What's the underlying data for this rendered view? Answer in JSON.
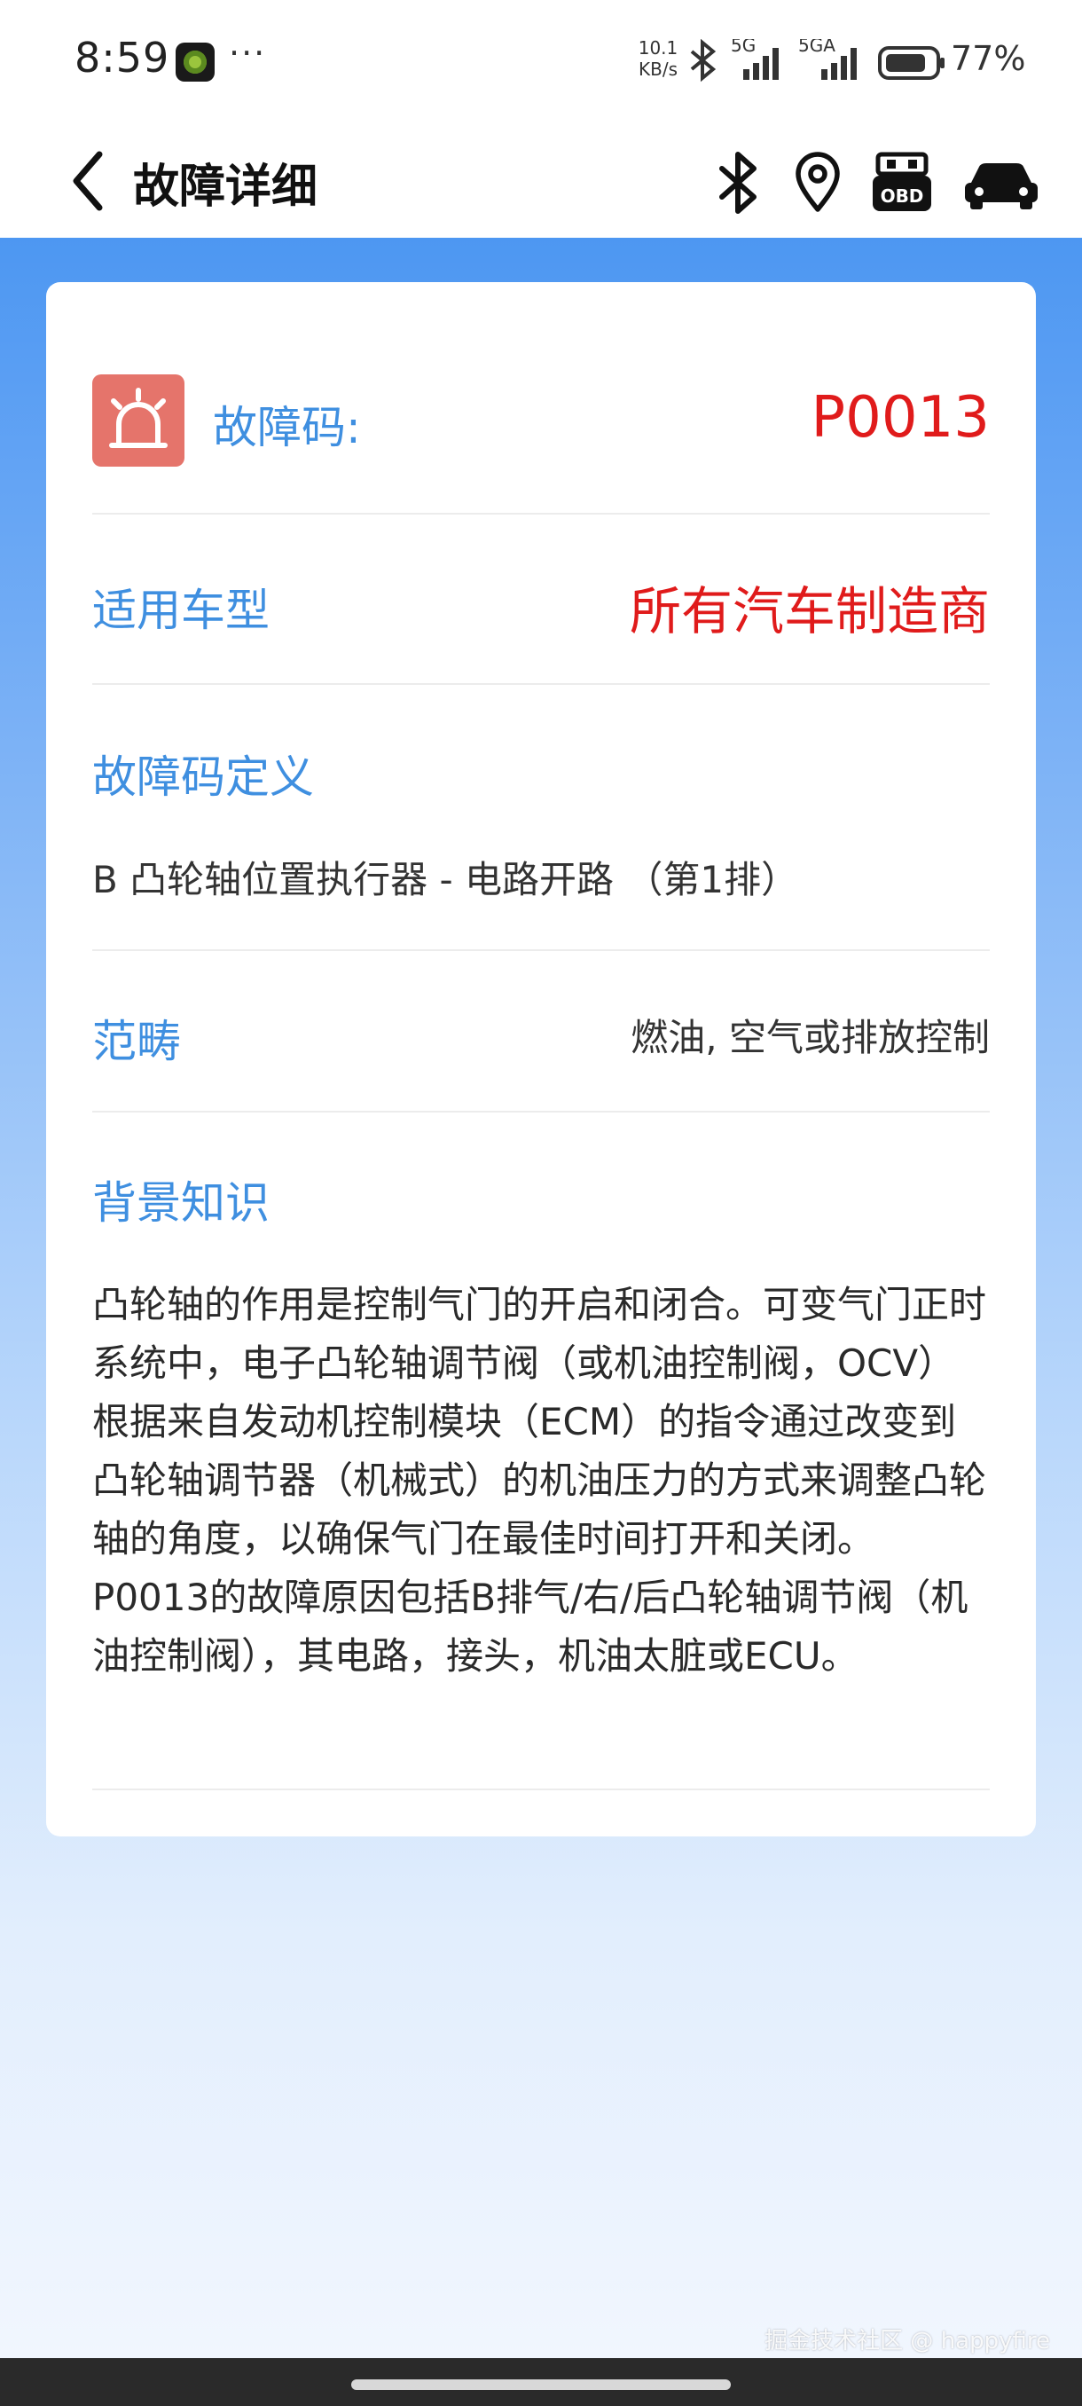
{
  "status_bar": {
    "time": "8:59",
    "more": "···",
    "net_speed_value": "10.1",
    "net_speed_unit": "KB/s",
    "signal1_label": "5G",
    "signal2_label": "5GA",
    "battery_percent": "77%"
  },
  "header": {
    "title": "故障详细",
    "icons": [
      "back-icon",
      "bluetooth-icon",
      "location-icon",
      "obd-icon",
      "car-icon"
    ],
    "obd_label": "OBD"
  },
  "fault": {
    "code_label": "故障码:",
    "code_value": "P0013",
    "model_label": "适用车型",
    "model_value": "所有汽车制造商",
    "definition_label": "故障码定义",
    "definition_text": "B 凸轮轴位置执行器 - 电路开路 （第1排）",
    "scope_label": "范畴",
    "scope_value": "燃油, 空气或排放控制",
    "background_label": "背景知识",
    "background_text": "凸轮轴的作用是控制气门的开启和闭合。可变气门正时系统中，电子凸轮轴调节阀（或机油控制阀，OCV）根据来自发动机控制模块（ECM）的指令通过改变到凸轮轴调节器（机械式）的机油压力的方式来调整凸轮轴的角度，以确保气门在最佳时间打开和关闭。P0013的故障原因包括B排气/右/后凸轮轴调节阀（机油控制阀），其电路，接头，机油太脏或ECU。"
  },
  "colors": {
    "accent_blue": "#3f8fe0",
    "code_red": "#e01b1b",
    "alarm_bg": "#e5746b"
  },
  "watermark": "掘金技术社区 @ happyfire"
}
